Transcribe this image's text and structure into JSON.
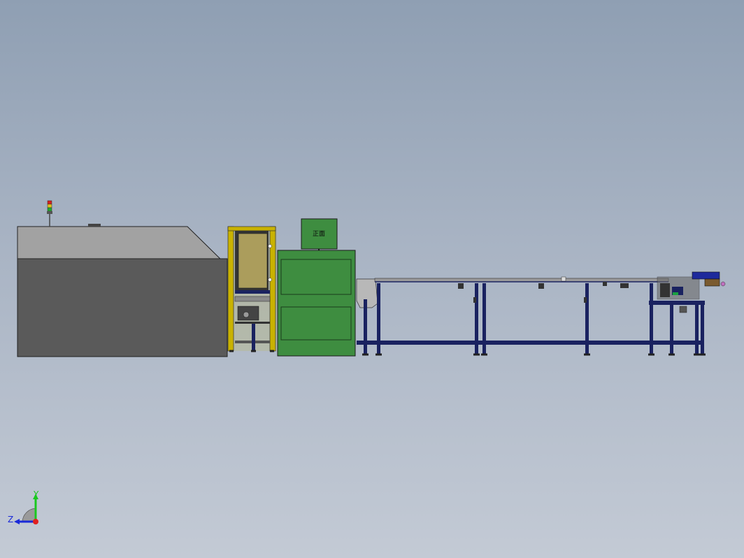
{
  "model_view": {
    "machine": {
      "display_label": "正面"
    },
    "triad": {
      "y_label": "Y",
      "z_label": "Z",
      "y_color": "#19c81e",
      "z_color": "#1a2ad8",
      "x_color": "#e02020"
    },
    "colors": {
      "enclosure_light": "#a2a2a2",
      "enclosure_dark": "#5a5a5a",
      "cabinet_green": "#3e8d40",
      "frame_yellow": "#c9b200",
      "conveyor_navy": "#1a2260",
      "panel_tan": "#ab9d5c"
    }
  }
}
